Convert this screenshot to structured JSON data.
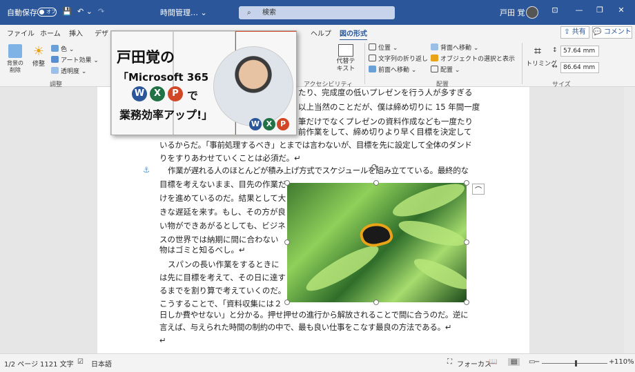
{
  "titlebar": {
    "autosave_label": "自動保存",
    "autosave_state": "オフ",
    "doc_title": "時間管理… ⌄",
    "search_placeholder": "検索",
    "user_name": "戸田 覚"
  },
  "tabs": [
    "ファイル",
    "ホーム",
    "挿入",
    "デザ",
    "ヘルプ",
    "図の形式"
  ],
  "active_tab": "図の形式",
  "share_label": "共有",
  "comment_label": "コメント",
  "ribbon": {
    "adjust": {
      "background_remove": "背景の削除",
      "correct": "修整",
      "color": "色 ⌄",
      "art_effect": "アート効果 ⌄",
      "transparency": "透明度 ⌄",
      "group_label": "調整"
    },
    "accessibility": {
      "alt_text": "代替テキスト",
      "group_label": "アクセシビリティ"
    },
    "arrange": {
      "position": "位置 ⌄",
      "wrap_text": "文字列の折り返し ⌄",
      "bring_forward": "前面へ移動 ⌄",
      "send_backward": "背面へ移動 ⌄",
      "selection_pane": "オブジェクトの選択と表示",
      "align": "配置 ⌄",
      "group_label": "配置"
    },
    "size": {
      "crop": "トリミング",
      "height": "57.64 mm",
      "width": "86.64 mm",
      "group_label": "サイズ"
    }
  },
  "document": {
    "line1": "たり、完成度の低いプレゼンを行う人が多すぎる",
    "line2": "以上当然のことだが、僕は締め切りに 15 年間一度",
    "line3": "筆だけでなくプレゼンの資料作成なども一度たり",
    "line4": "前作業をして、締め切りより早く目標を決定して",
    "line5": "いるからだ。「事前処理するべき」とまでは言わないが、目標を先に設定して全体のダンド",
    "line6": "りをすりあわせていくことは必須だ。↵",
    "line7": "作業が遅れる人のほとんどが積み上げ方式でスケジュールを組み立てている。最終的な",
    "line8": "目標を考えないまま、目先の作業だ",
    "line9": "けを進めているのだ。結果として大",
    "line10": "きな遅延を来す。もし、その方が良",
    "line11": "い物ができあがるとしても、ビジネ",
    "line12": "スの世界では納期に間に合わない",
    "line13": "物はゴミと知るべし。↵",
    "line14": "スパンの長い作業をするときに",
    "line15": "は先に目標を考えて、その日に達す",
    "line16": "るまでを割り算で考えていくのだ。",
    "line17": "こうすることで、「資料収集には２",
    "line18": "日しか費やせない」と分かる。押せ押せの進行から解放されることで間に合うのだ。逆に",
    "line19": "言えば、与えられた時間の制約の中で、最も良い仕事をこなす最良の方法である。↵",
    "line20": "↵"
  },
  "banner": {
    "title_line1": "戸田覚の",
    "title_line2": "「Microsoft 365",
    "title_line3": "業務効率アップ!」",
    "with_text": "で",
    "badges": [
      "W",
      "X",
      "P"
    ],
    "badge_colors": [
      "#2b579a",
      "#217346",
      "#d24726"
    ]
  },
  "statusbar": {
    "page": "1/2 ページ",
    "words": "1121 文字",
    "language": "日本語",
    "focus": "フォーカス",
    "zoom": "110%"
  }
}
